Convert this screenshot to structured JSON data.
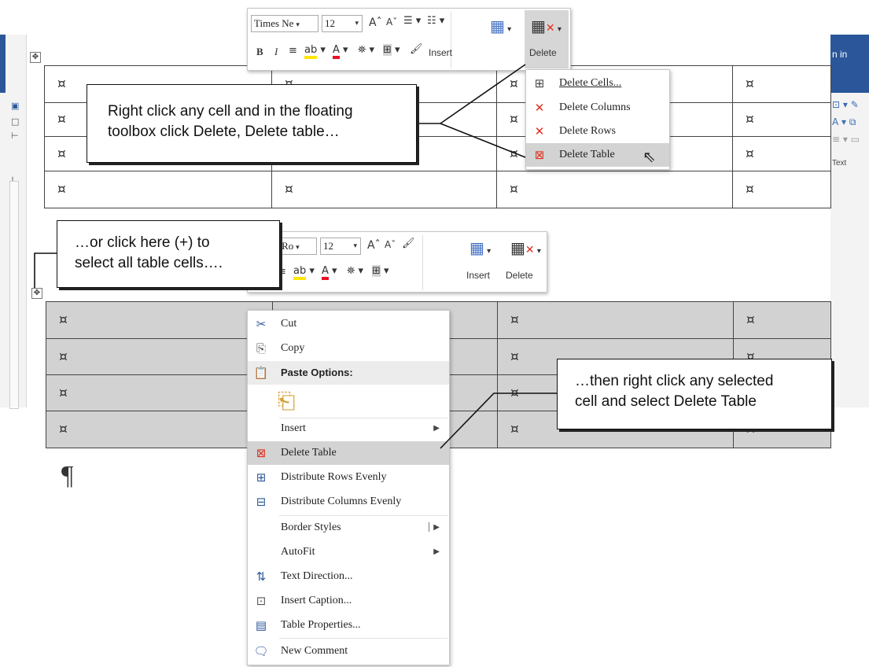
{
  "window": {
    "right_tab_text": "n in",
    "right_group_label": "Text"
  },
  "table_top": {
    "cell_glyph": "¤",
    "rows": [
      [
        "¤",
        "¤",
        "¤",
        "¤"
      ],
      [
        "¤",
        "¤",
        "¤",
        "¤"
      ],
      [
        "¤",
        "¤",
        "¤",
        "¤"
      ],
      [
        "¤",
        "¤",
        "¤",
        "¤"
      ]
    ]
  },
  "table_bottom": {
    "rows": [
      [
        "¤",
        "¤",
        "¤",
        "¤"
      ],
      [
        "¤",
        "¤",
        "¤",
        "¤"
      ],
      [
        "¤",
        "¤",
        "¤",
        "¤"
      ],
      [
        "¤",
        "¤",
        "¤",
        "¤"
      ]
    ],
    "end_mark": "¶"
  },
  "toolbar_top": {
    "font_name": "Times Ne",
    "font_size": "12",
    "insert_label": "Insert",
    "delete_label": "Delete"
  },
  "toolbar_bottom": {
    "font_name": "s New Ro",
    "font_size": "12",
    "insert_label": "Insert",
    "delete_label": "Delete"
  },
  "delete_menu": {
    "items": [
      {
        "label": "Delete Cells...",
        "icon": "delete-cells-icon"
      },
      {
        "label": "Delete Columns",
        "icon": "delete-columns-icon"
      },
      {
        "label": "Delete Rows",
        "icon": "delete-rows-icon"
      },
      {
        "label": "Delete Table",
        "icon": "delete-table-icon",
        "highlighted": true
      }
    ]
  },
  "context_menu": {
    "cut": "Cut",
    "copy": "Copy",
    "paste_header": "Paste Options:",
    "insert": "Insert",
    "delete_table": "Delete Table",
    "distribute_rows": "Distribute Rows Evenly",
    "distribute_columns": "Distribute Columns Evenly",
    "border_styles": "Border Styles",
    "autofit": "AutoFit",
    "text_direction": "Text Direction...",
    "insert_caption": "Insert Caption...",
    "table_properties": "Table Properties...",
    "new_comment": "New Comment"
  },
  "callouts": {
    "c1_line1": "Right click any cell and in the floating",
    "c1_line2": "toolbox click Delete, Delete table…",
    "c2_line1": "…or click here (+) to",
    "c2_line2": "select all table cells….",
    "c3_line1": "…then right click any selected",
    "c3_line2": "cell and select Delete Table"
  },
  "colors": {
    "word_blue": "#2b579a",
    "selection_gray": "#d2d2d2",
    "menu_highlight": "#d3d3d3",
    "delete_red": "#e0301e",
    "font_color_red": "#e81123",
    "highlight_yellow": "#ffe600"
  }
}
